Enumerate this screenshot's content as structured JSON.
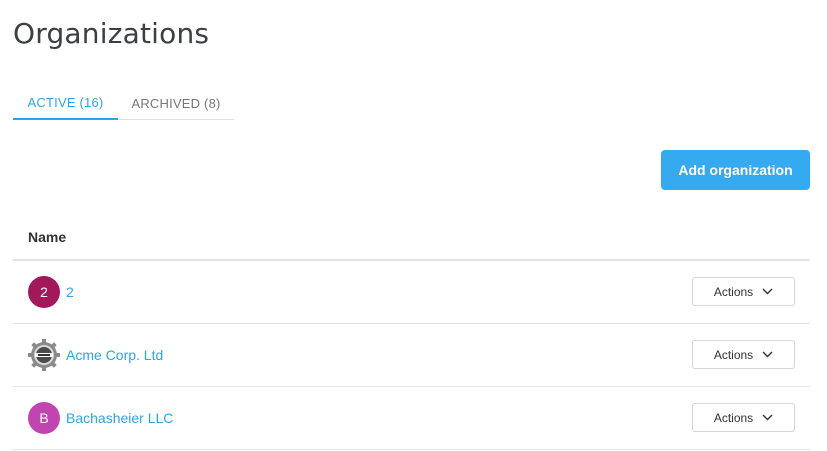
{
  "page": {
    "title": "Organizations"
  },
  "tabs": [
    {
      "label": "ACTIVE (16)",
      "active": true
    },
    {
      "label": "ARCHIVED (8)",
      "active": false
    }
  ],
  "toolbar": {
    "add_label": "Add organization"
  },
  "table": {
    "columns": [
      "Name"
    ],
    "rows": [
      {
        "avatar_text": "2",
        "avatar_color": "#a3185a",
        "avatar_type": "initial",
        "name": "2",
        "actions_label": "Actions"
      },
      {
        "avatar_text": "",
        "avatar_color": "#6b6b6b",
        "avatar_type": "logo",
        "name": "Acme Corp. Ltd",
        "actions_label": "Actions"
      },
      {
        "avatar_text": "B",
        "avatar_color": "#c045b0",
        "avatar_type": "initial",
        "name": "Bachasheier LLC",
        "actions_label": "Actions"
      }
    ]
  },
  "colors": {
    "accent": "#2ea4e8",
    "button": "#36aaf0"
  }
}
